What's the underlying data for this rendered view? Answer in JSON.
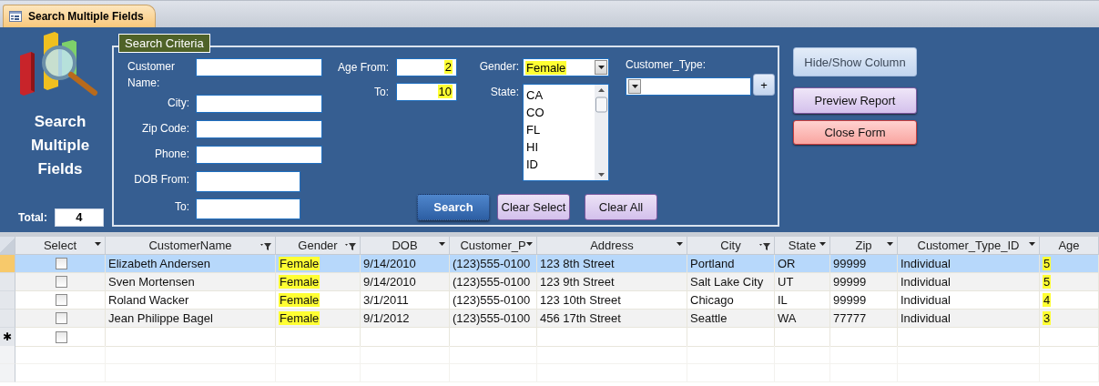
{
  "tab": {
    "label": "Search Multiple Fields",
    "selected": true
  },
  "form": {
    "title": "Search Multiple Fields",
    "total": {
      "label": "Total:",
      "value": "4"
    },
    "criteria": {
      "legend": "Search Criteria",
      "text_fields": [
        {
          "label": "Customer Name:",
          "kind": "long"
        },
        {
          "label": "City:",
          "kind": "long"
        },
        {
          "label": "Zip Code:",
          "kind": "long"
        },
        {
          "label": "Phone:",
          "kind": "long"
        },
        {
          "label": "DOB From:",
          "kind": "short"
        },
        {
          "label": "To:",
          "kind": "short"
        }
      ],
      "age_fields": [
        {
          "label": "Age From:",
          "value": "2",
          "highlighted": true
        },
        {
          "label": "To:",
          "value": "10",
          "highlighted": true
        }
      ],
      "gender": {
        "label": "Gender:",
        "value": "Female",
        "highlighted": true
      },
      "state": {
        "label": "State:",
        "options": [
          {
            "label": "CA",
            "selected": false
          },
          {
            "label": "CO",
            "selected": false
          },
          {
            "label": "FL",
            "selected": false
          },
          {
            "label": "HI",
            "selected": false
          },
          {
            "label": "ID",
            "selected": false
          }
        ]
      },
      "customer_type": {
        "label": "Customer_Type:",
        "add_button": "+"
      },
      "buttons": [
        {
          "label": "Search",
          "kind": "primary"
        },
        {
          "label": "Clear Select",
          "kind": "secondary"
        },
        {
          "label": "Clear All",
          "kind": "secondary"
        }
      ]
    },
    "side_buttons": [
      {
        "label": "Hide/Show Column",
        "kind": "blue"
      },
      {
        "label": "Preview Report",
        "kind": "purple"
      },
      {
        "label": "Close Form",
        "kind": "red"
      }
    ]
  },
  "datasheet": {
    "columns": [
      {
        "label": "Select",
        "kind": "dropdown",
        "highlighted": false
      },
      {
        "label": "CustomerName",
        "kind": "filter",
        "highlighted": false
      },
      {
        "label": "Gender",
        "kind": "filter",
        "highlighted": true
      },
      {
        "label": "DOB",
        "kind": "dropdown",
        "highlighted": false
      },
      {
        "label": "Customer_P",
        "kind": "dropdown",
        "highlighted": false
      },
      {
        "label": "Address",
        "kind": "dropdown",
        "highlighted": false
      },
      {
        "label": "City",
        "kind": "filter",
        "highlighted": false
      },
      {
        "label": "State",
        "kind": "dropdown",
        "highlighted": false
      },
      {
        "label": "Zip",
        "kind": "dropdown",
        "highlighted": false
      },
      {
        "label": "Customer_Type_ID",
        "kind": "dropdown",
        "highlighted": false
      },
      {
        "label": "Age",
        "kind": "plain",
        "highlighted": true
      }
    ],
    "rows": [
      {
        "selected": true,
        "checked": false,
        "cells": [
          "",
          "Elizabeth Andersen",
          "Female",
          "9/14/2010",
          "(123)555-0100",
          "123 8th Street",
          "Portland",
          "OR",
          "99999",
          "Individual",
          "5"
        ]
      },
      {
        "selected": false,
        "checked": false,
        "cells": [
          "",
          "Sven Mortensen",
          "Female",
          "9/14/2010",
          "(123)555-0100",
          "123 9th Street",
          "Salt Lake City",
          "UT",
          "99999",
          "Individual",
          "5"
        ]
      },
      {
        "selected": false,
        "checked": false,
        "cells": [
          "",
          "Roland Wacker",
          "Female",
          "3/1/2011",
          "(123)555-0100",
          "123 10th Street",
          "Chicago",
          "IL",
          "99999",
          "Individual",
          "4"
        ]
      },
      {
        "selected": false,
        "checked": false,
        "cells": [
          "",
          "Jean Philippe Bagel",
          "Female",
          "9/1/2012",
          "(123)555-0100",
          "456 17th Street",
          "Seattle",
          "WA",
          "77777",
          "Individual",
          "3"
        ]
      }
    ],
    "new_row": {
      "marker": "✱",
      "checked": false
    }
  }
}
